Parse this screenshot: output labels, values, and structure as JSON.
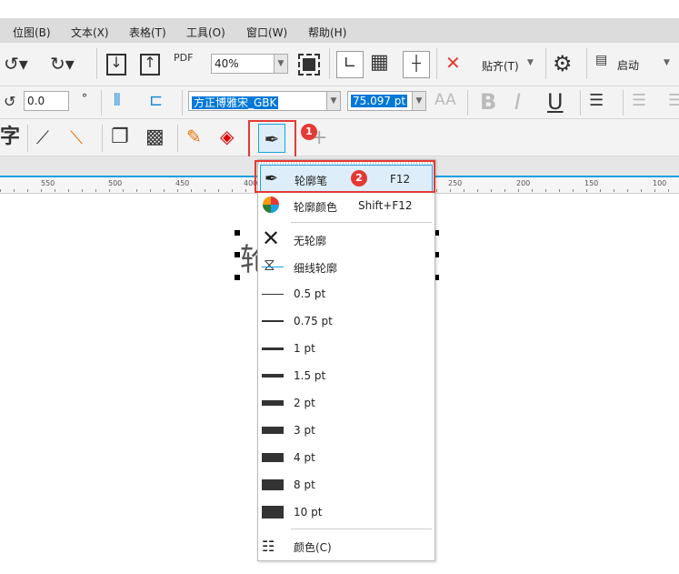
{
  "menubar": [
    "位图(B)",
    "文本(X)",
    "表格(T)",
    "工具(O)",
    "窗口(W)",
    "帮助(H)"
  ],
  "toolbar1": {
    "pdf": "PDF",
    "zoom": "40%",
    "snap": "贴齐(T)",
    "launch": "启动"
  },
  "toolbar2": {
    "angle": "0.0",
    "degree": "°",
    "font": "方正博雅宋_GBK",
    "size": "75.097 pt",
    "bold": "B",
    "italic": "I",
    "underline": "U"
  },
  "toolbar3": {
    "char": "字",
    "plus": "+"
  },
  "ruler": [
    "550",
    "500",
    "450",
    "400",
    "250",
    "200",
    "150",
    "100"
  ],
  "canvas_text": "轮",
  "badges": [
    "1",
    "2"
  ],
  "menu": {
    "items": [
      {
        "label": "轮廓笔",
        "shortcut": "F12"
      },
      {
        "label": "轮廓颜色",
        "shortcut": "Shift+F12"
      },
      {
        "label": "无轮廓"
      },
      {
        "label": "细线轮廓"
      },
      {
        "label": "0.5 pt",
        "w": 1
      },
      {
        "label": "0.75 pt",
        "w": 2
      },
      {
        "label": "1 pt",
        "w": 3
      },
      {
        "label": "1.5 pt",
        "w": 4
      },
      {
        "label": "2 pt",
        "w": 6
      },
      {
        "label": "3 pt",
        "w": 8
      },
      {
        "label": "4 pt",
        "w": 10
      },
      {
        "label": "8 pt",
        "w": 12
      },
      {
        "label": "10 pt",
        "w": 14
      },
      {
        "label": "颜色(C)"
      }
    ]
  },
  "colors": {
    "accent": "#1ba1e2",
    "highlight": "#e53935",
    "selection": "#0078d7"
  }
}
